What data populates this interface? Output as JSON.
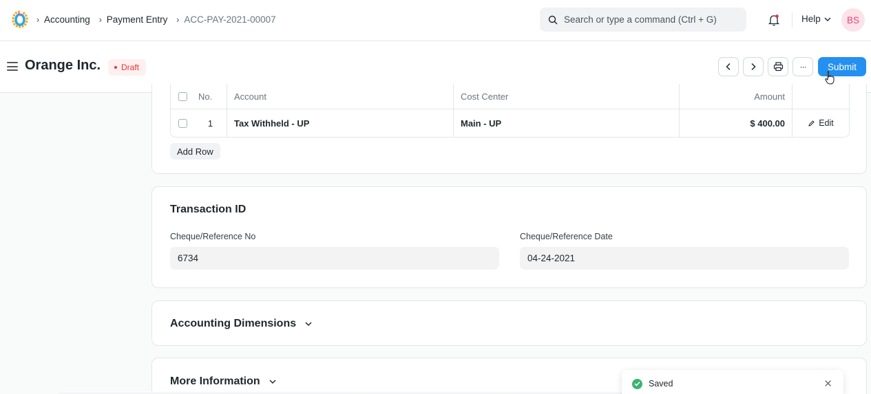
{
  "navbar": {
    "breadcrumbs": [
      "Accounting",
      "Payment Entry",
      "ACC-PAY-2021-00007"
    ],
    "search_placeholder": "Search or type a command (Ctrl + G)",
    "help_label": "Help",
    "avatar_initials": "BS"
  },
  "page": {
    "title": "Orange Inc.",
    "status": "Draft",
    "submit_label": "Submit",
    "more_label": "···"
  },
  "deductions_table": {
    "columns": [
      "No.",
      "Account",
      "Cost Center",
      "Amount"
    ],
    "rows": [
      {
        "no": "1",
        "account": "Tax Withheld - UP",
        "cost_center": "Main - UP",
        "amount": "$ 400.00",
        "edit": "Edit"
      }
    ],
    "add_row_label": "Add Row"
  },
  "transaction": {
    "title": "Transaction ID",
    "ref_no_label": "Cheque/Reference No",
    "ref_no_value": "6734",
    "ref_date_label": "Cheque/Reference Date",
    "ref_date_value": "04-24-2021"
  },
  "sections": {
    "accounting_dimensions": "Accounting Dimensions",
    "more_information": "More Information"
  },
  "toast": {
    "message": "Saved"
  },
  "colors": {
    "primary": "#2490ef",
    "draft_red": "#e03636",
    "success": "#3cb371"
  }
}
